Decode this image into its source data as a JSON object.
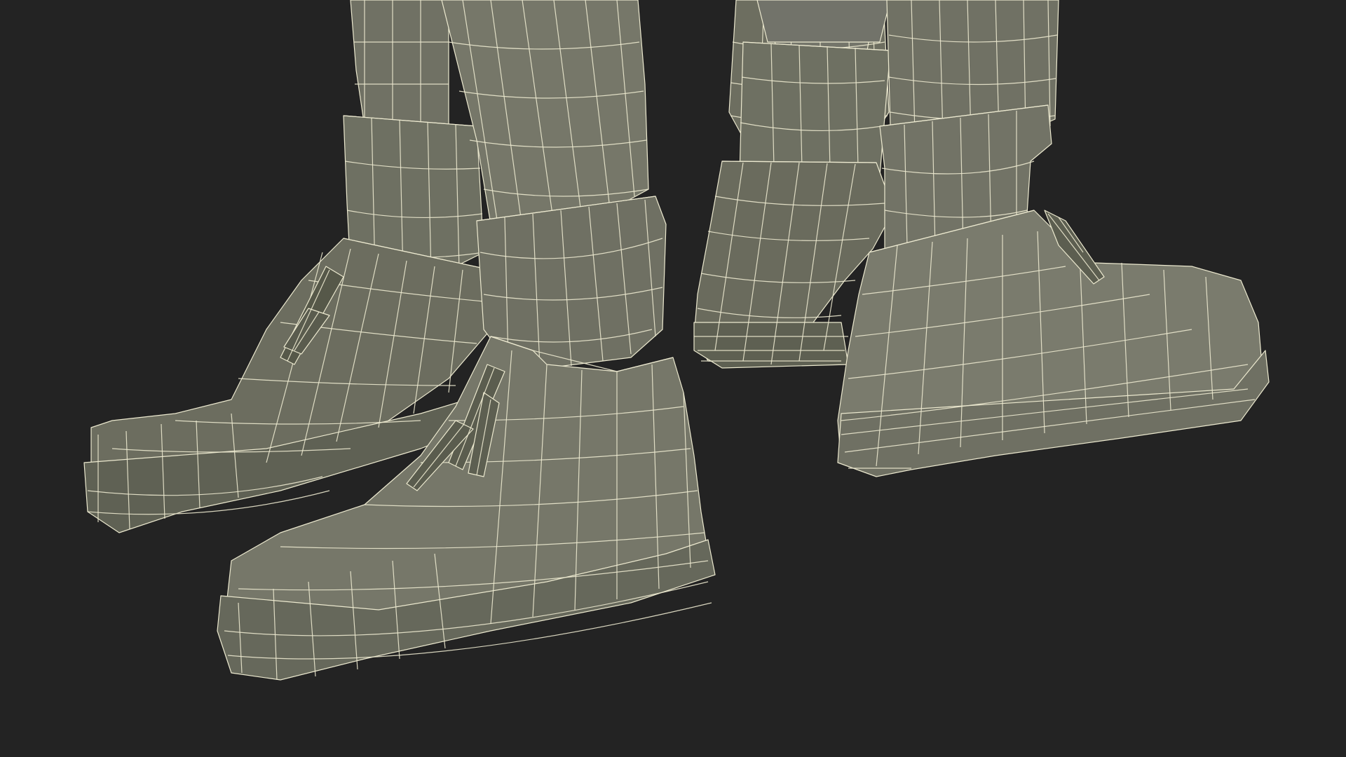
{
  "viewport": {
    "background_color": "#232323",
    "mesh_light": "#7b7b6c",
    "mesh_mid": "#6a6b5d",
    "mesh_dark": "#55584b",
    "wire_color": "#ece9cf"
  },
  "model": {
    "kind": "wireframe-3d-model",
    "subject": "pair-of-legs-with-boots"
  }
}
